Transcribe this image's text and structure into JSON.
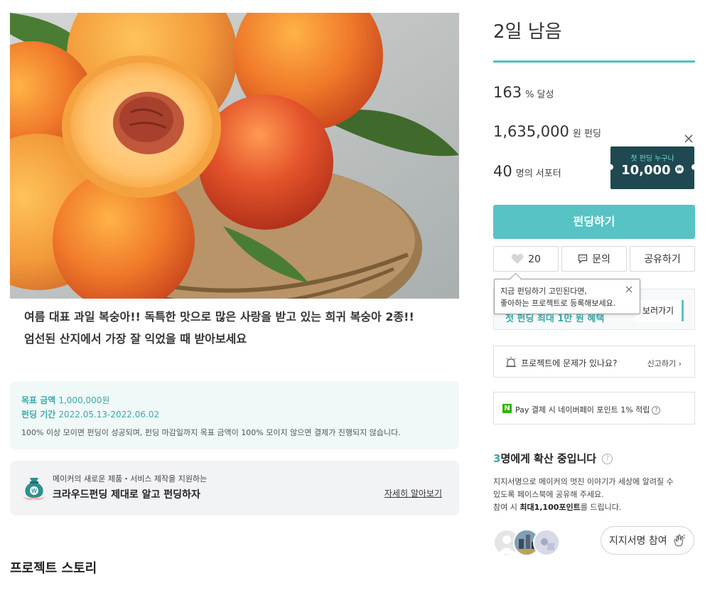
{
  "project": {
    "summary_line1": "여름 대표 과일 복숭아!! 독특한 맛으로 많은 사랑을 받고 있는 희귀 복숭아 2종!!",
    "summary_line2": "엄선된 산지에서 가장 잘 익었을 때 받아보세요"
  },
  "goal_box": {
    "goal_label": "목표 금액",
    "goal_value": "1,000,000원",
    "period_label": "펀딩 기간",
    "period_value": "2022.05.13-2022.06.02",
    "notice": "100% 이상 모이면 펀딩이 성공되며, 펀딩 마감일까지 목표 금액이 100% 모이지 않으면 결제가 진행되지 않습니다."
  },
  "guide_banner": {
    "small": "메이커의 새로운 제품・서비스 제작을 지원하는",
    "big": "크라우드펀딩 제대로 알고 펀딩하자",
    "link": "자세히 알아보기"
  },
  "story_title": "프로젝트 스토리",
  "sidebar": {
    "days_left": "2일 남음",
    "percent": "163",
    "percent_unit": "% 달성",
    "amount": "1,635,000",
    "amount_unit": "원 펀딩",
    "supporters": "40",
    "supporters_unit": "명의 서포터",
    "coupon_title": "첫 펀딩 누구나",
    "coupon_value": "10,000",
    "coupon_w": "w",
    "fund_button": "펀딩하기",
    "like_count": "20",
    "inquiry_label": "문의",
    "share_label": "공유하기",
    "tooltip_line1": "지금 펀딩하기 고민된다면,",
    "tooltip_line2": "좋아하는 프로젝트로 등록해보세요.",
    "event_text": "첫 펀딩 최대 1만 원 혜택",
    "event_button": "보러가기",
    "report_text": "프로젝트에 문제가 있나요?",
    "report_link": "신고하기 ›",
    "naver_badge": "N",
    "naver_text": "Pay 결제 시 네이버페이 포인트 1% 적립",
    "spread_count": "3",
    "spread_title_rest": "명에게 확산 중입니다",
    "question_mark": "?",
    "spread_desc1": "지지서명으로 메이커의 멋진 이야기가 세상에 알려질 수",
    "spread_desc2": "있도록 페이스북에 공유해 주세요.",
    "spread_desc3_a": "참여 시 ",
    "spread_desc3_b": "최대1,100포인트",
    "spread_desc3_c": "를 드립니다.",
    "sign_button": "지지서명 참여"
  },
  "colors": {
    "accent": "#58c3c4",
    "accent_text": "#3aa9ab",
    "coupon_bg": "#1f4850",
    "naver_green": "#2db400"
  }
}
